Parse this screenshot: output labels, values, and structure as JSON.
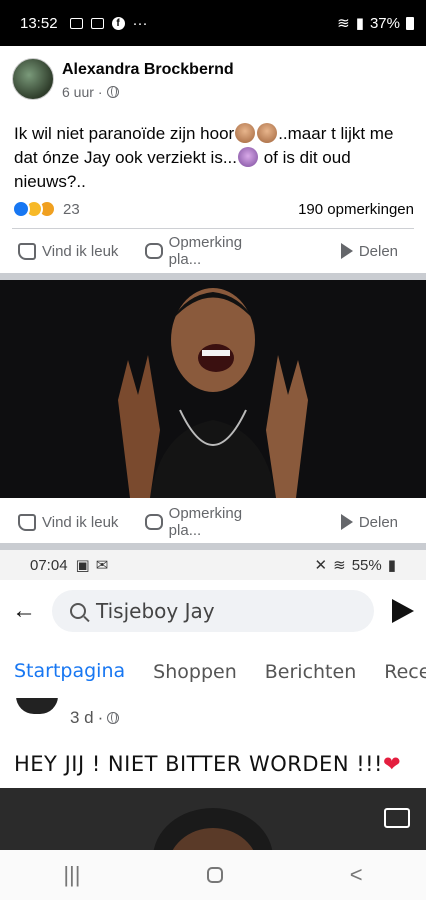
{
  "status_bar": {
    "time": "13:52",
    "battery": "37%"
  },
  "post": {
    "author": "Alexandra Brockbernd",
    "time": "6 uur",
    "text_part1": "Ik wil niet paranoïde zijn hoor",
    "text_part2": "..maar t lijkt me dat ónze Jay ook verziekt is...",
    "text_part3": " of is dit oud nieuws?..",
    "reaction_count": "23",
    "comment_count": "190 opmerkingen"
  },
  "actions": {
    "like": "Vind ik leuk",
    "comment": "Opmerking pla...",
    "share": "Delen"
  },
  "embedded": {
    "status_time": "07:04",
    "battery": "55%",
    "search_text": "Tisjeboy Jay",
    "tabs": [
      "Startpagina",
      "Shoppen",
      "Berichten",
      "Recen"
    ],
    "post_time": "3 d",
    "post_text": "HEY JIJ ! NIET BITTER WORDEN !!!"
  },
  "nav": {
    "recent": "|||",
    "back": "<"
  }
}
